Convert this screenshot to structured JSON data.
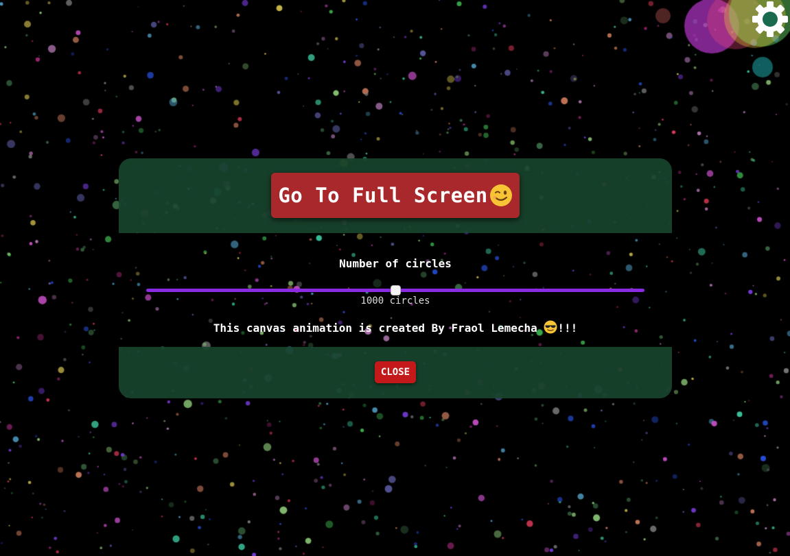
{
  "modal": {
    "fullscreen_label": "Go To Full Screen",
    "fullscreen_emoji": "winking-face-icon",
    "slider_label": "Number of circles",
    "slider": {
      "value": 1000,
      "fraction": 0.5
    },
    "count_value": "1000",
    "count_unit": "circles",
    "credit_text": "This canvas animation is created By Fraol Lemecha",
    "credit_emoji": "sunglasses-face-icon",
    "credit_suffix": "!!!",
    "close_label": "CLOSE"
  },
  "settings": {
    "icon": "gear-icon"
  },
  "colors": {
    "modal_panel": "#18442d",
    "fullscreen_button": "#a8282b",
    "close_button": "#c4191b",
    "slider_track": "#8a2be2",
    "background": "#000000"
  }
}
